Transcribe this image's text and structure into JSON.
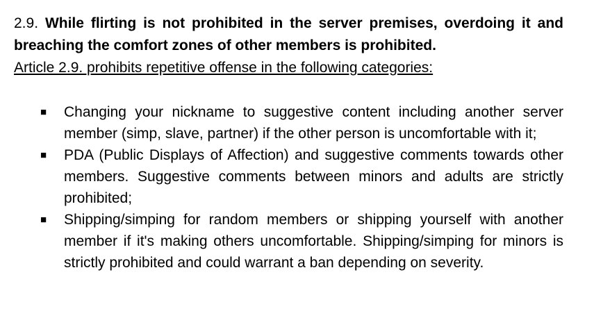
{
  "rule": {
    "number": "2.9.",
    "heading": "While flirting is not prohibited in the server premises, overdoing it and breaching the comfort zones of other members is prohibited.",
    "subheading": "Article 2.9. prohibits repetitive offense in the following categories:"
  },
  "bullet_icon": "black-square-icon",
  "items": [
    {
      "text": "Changing your nickname to suggestive content including another server member (simp, slave, partner) if the other person is uncomfortable with it;"
    },
    {
      "text": "PDA (Public Displays of Affection) and suggestive comments towards other members. Suggestive comments between minors and adults are strictly prohibited;"
    },
    {
      "text": "Shipping/simping for random members or shipping yourself with another member if it's making others uncomfortable. Shipping/simping for minors is strictly prohibited and could warrant a ban depending on severity."
    }
  ]
}
